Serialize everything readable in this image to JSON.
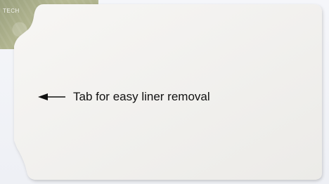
{
  "backing_card": {
    "text": "TECH",
    "color": "#a7ab86"
  },
  "card": {
    "color": "#f1f0ee"
  },
  "annotation": {
    "label": "Tab for easy liner removal",
    "arrow_direction": "left"
  }
}
